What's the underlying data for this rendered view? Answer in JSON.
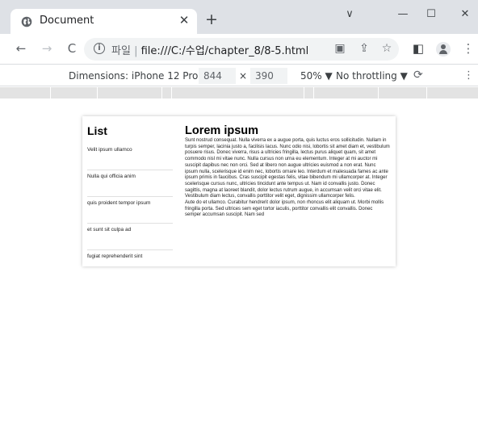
{
  "browser": {
    "tab_title": "Document",
    "url_prefix": "파일",
    "url": "file:///C:/수업/chapter_8/8-5.html",
    "icons": {
      "back": "back-arrow-icon",
      "forward": "forward-arrow-icon",
      "reload": "reload-icon",
      "info": "info-icon",
      "translate": "translate-icon",
      "share": "share-icon",
      "bookmark": "star-icon",
      "side_panel": "side-panel-icon",
      "profile": "profile-icon",
      "menu": "kebab-menu-icon"
    }
  },
  "window_controls": {
    "dropdown": "∨",
    "minimize": "—",
    "maximize": "☐",
    "close": "✕"
  },
  "devtools": {
    "dimensions_label": "Dimensions: iPhone 12 Pro ▼",
    "width": "844",
    "times": "×",
    "height": "390",
    "zoom": "50% ▼",
    "throttling": "No throttling ▼"
  },
  "page": {
    "list_heading": "List",
    "list_items": [
      "Velit ipsum ullamco",
      "Nulla qui officia anim",
      "quis proident tempor ipsum",
      "et sunt sit culpa ad",
      "fugiat reprehenderit sint"
    ],
    "article_title": "Lorem ipsum",
    "article_body": "Sunt nostrud consequat. Nulla viverra ex a augue porta, quis luctus eros sollicitudin. Nullam in turpis semper, lacinia justo a, facilisis lacus. Nunc odio nisi, lobortis sit amet diam et, vestibulum posuere risus. Donec viverra, risus a ultricies fringilla, lectus purus aliquet quam, sit amet commodo nisl mi vitae nunc. Nulla cursus non urna eu elementum. Integer at mi auctor mi suscipit dapibus nec non orci. Sed at libero non augue ultricies euismod a non erat. Nunc ipsum nulla, scelerisque id enim nec, lobortis ornare leo. Interdum et malesuada fames ac ante ipsum primis in faucibus. Cras suscipit egestas felis, vitae bibendum mi ullamcorper at. Integer scelerisque cursus nunc, ultricies tincidunt ante tempus ut. Nam id convallis justo. Donec sagittis, magna at laoreet blandit, dolor lectus rutrum augue, in accumsan velit orci vitae elit. Vestibulum diam lectus, convallis porttitor velit eget, dignissim ullamcorper felis.",
    "article_body_2": "Aute do et ullamco. Curabitur hendrerit dolor ipsum, non rhoncus elit aliquam ut. Morbi mollis fringilla porta. Sed ultrices sem eget tortor iaculis, porttitor convallis elit convallis. Donec semper accumsan suscipit. Nam sed"
  }
}
